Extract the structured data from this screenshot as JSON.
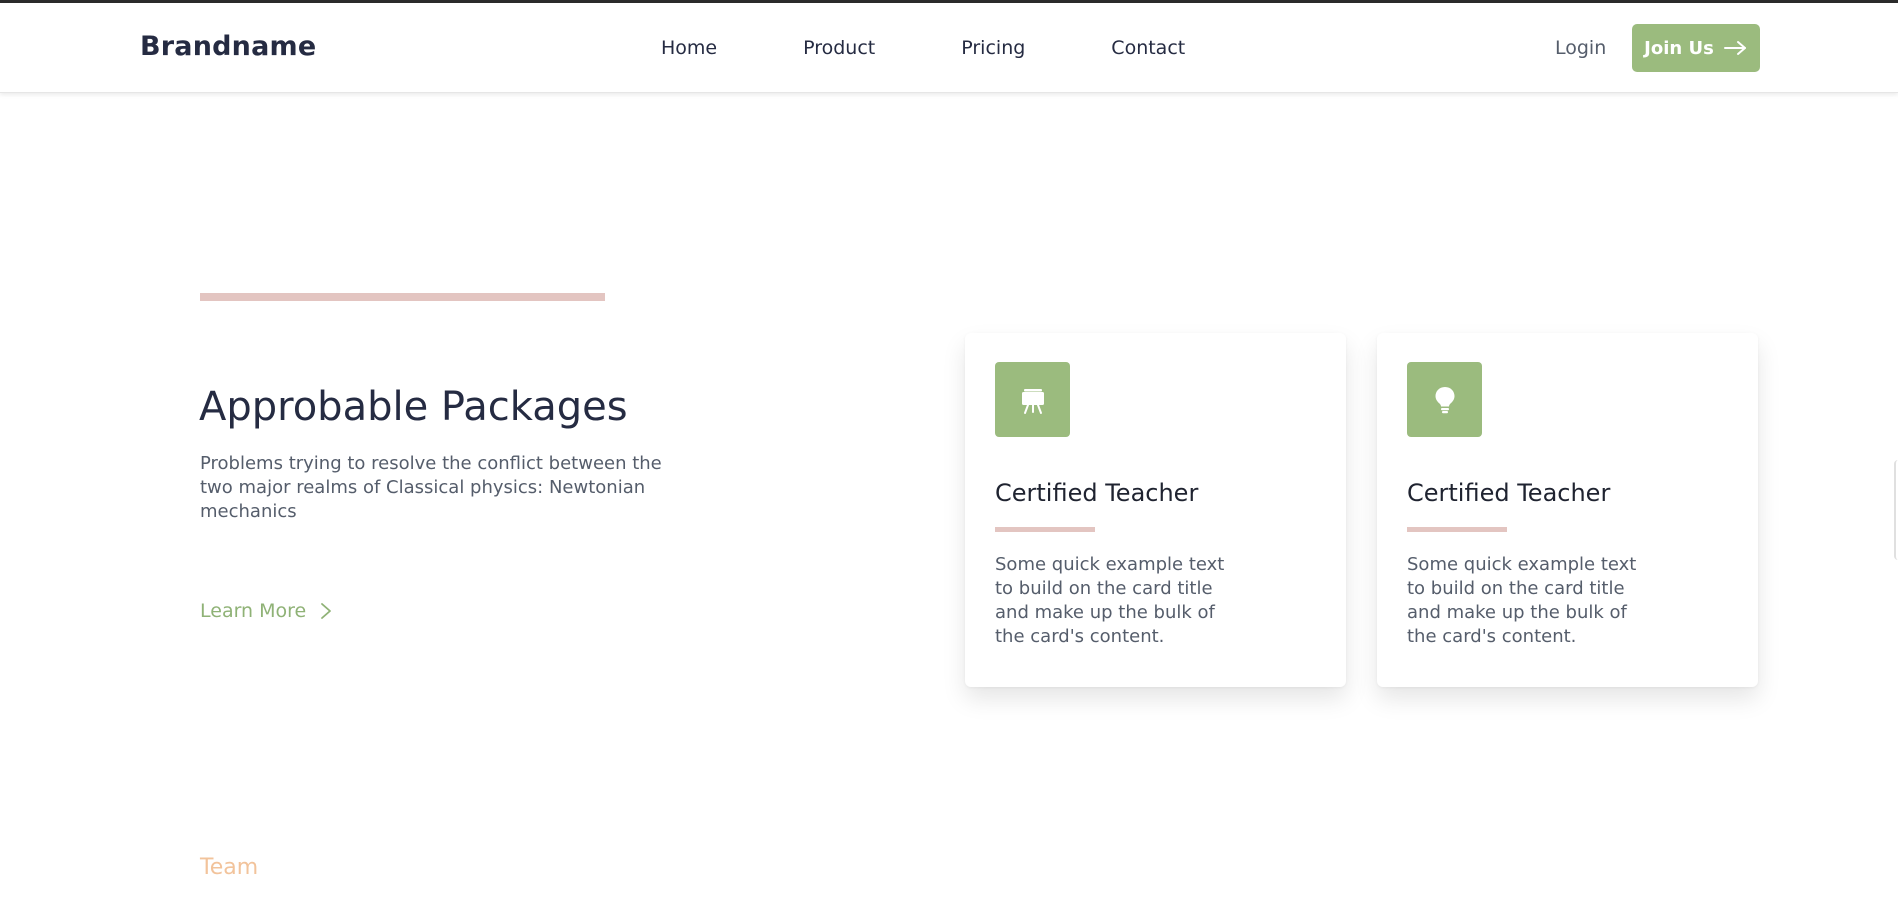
{
  "header": {
    "brand": "Brandname",
    "nav": [
      "Home",
      "Product",
      "Pricing",
      "Contact"
    ],
    "login_label": "Login",
    "join_label": "Join Us",
    "join_icon": "arrow-right-icon"
  },
  "hero": {
    "title": "Approbable Packages",
    "description": "Problems trying to resolve the conflict between the two major realms of Classical physics: Newtonian mechanics",
    "learn_more_label": "Learn More",
    "learn_more_icon": "chevron-right-icon"
  },
  "cards": [
    {
      "icon": "easel-icon",
      "title": "Certified Teacher",
      "text": "Some quick example text to build on the card title and make up the bulk of the card's content."
    },
    {
      "icon": "lightbulb-icon",
      "title": "Certified Teacher",
      "text": "Some quick example text to build on the card title and make up the bulk of the card's content."
    }
  ],
  "next_section": {
    "label": "Team"
  },
  "colors": {
    "primary": "#9bbb7e",
    "accent_pink": "#e3c5c1",
    "heading": "#252b42",
    "muted_text": "#555d6b",
    "team_orange": "#f2c39b"
  }
}
